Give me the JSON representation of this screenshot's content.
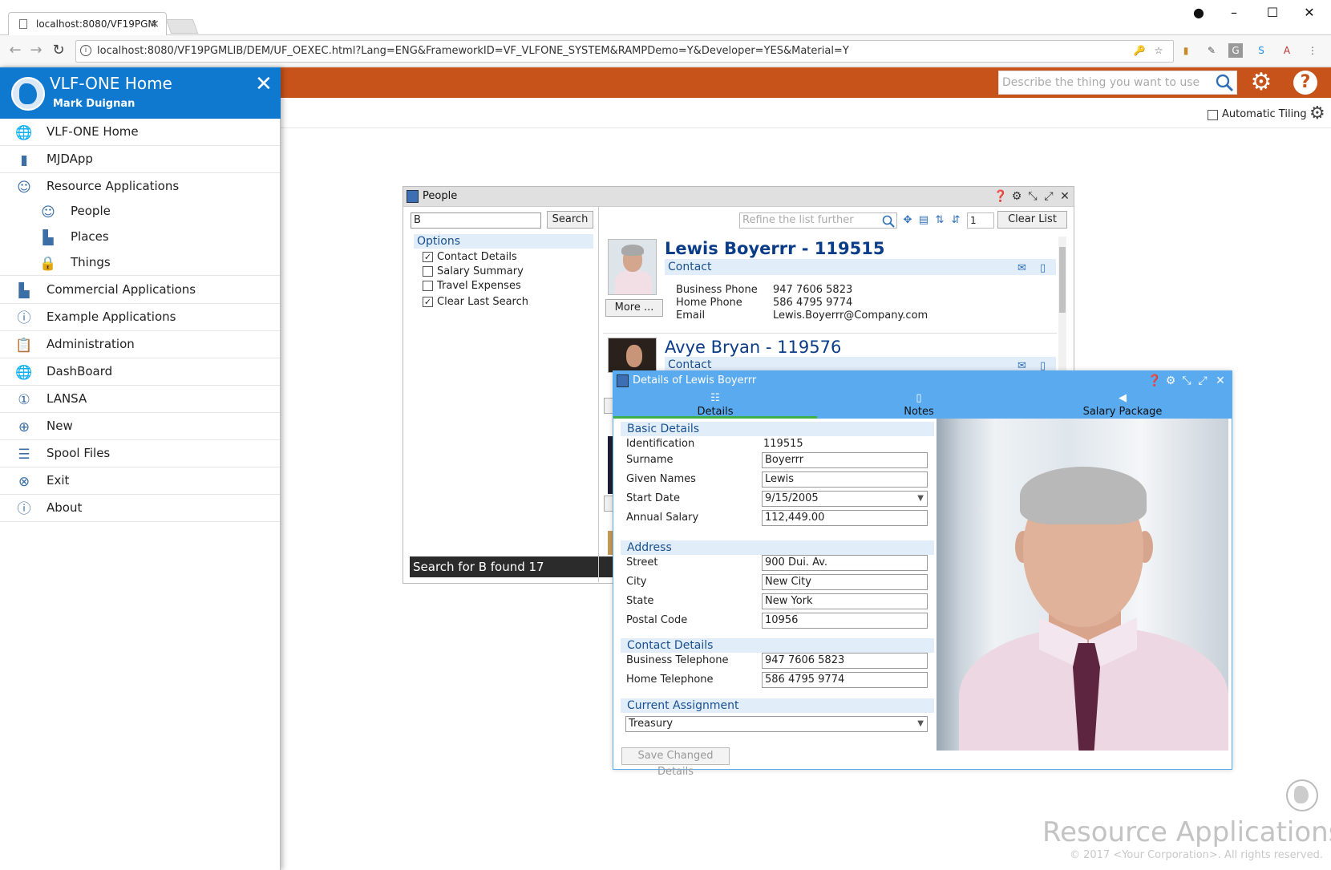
{
  "browser": {
    "tab_title": "localhost:8080/VF19PGM",
    "url": "localhost:8080/VF19PGMLIB/DEM/UF_OEXEC.html?Lang=ENG&FrameworkID=VF_VLFONE_SYSTEM&RAMPDemo=Y&Developer=YES&Material=Y"
  },
  "header": {
    "search_placeholder": "Describe the thing you want to use",
    "auto_tiling_label": "Automatic Tiling",
    "accent_color": "#c7531a"
  },
  "sidebar": {
    "title": "VLF-ONE Home",
    "user": "Mark Duignan",
    "items": [
      {
        "label": "VLF-ONE Home",
        "icon": "globe-icon"
      },
      {
        "label": "MJDApp",
        "icon": "document-icon"
      },
      {
        "label": "Resource Applications",
        "icon": "person-icon"
      },
      {
        "label": "People",
        "icon": "person-icon"
      },
      {
        "label": "Places",
        "icon": "factory-icon"
      },
      {
        "label": "Things",
        "icon": "lock-icon"
      },
      {
        "label": "Commercial Applications",
        "icon": "factory-icon"
      },
      {
        "label": "Example Applications",
        "icon": "info-icon"
      },
      {
        "label": "Administration",
        "icon": "clipboard-icon"
      },
      {
        "label": "DashBoard",
        "icon": "globe-icon"
      },
      {
        "label": "LANSA",
        "icon": "number-one-icon"
      },
      {
        "label": "New",
        "icon": "plus-icon"
      },
      {
        "label": "Spool Files",
        "icon": "list-icon"
      },
      {
        "label": "Exit",
        "icon": "exit-icon"
      },
      {
        "label": "About",
        "icon": "info-icon"
      }
    ]
  },
  "people": {
    "title": "People",
    "search_value": "B",
    "search_button": "Search",
    "options_header": "Options",
    "options": [
      {
        "label": "Contact Details",
        "checked": true
      },
      {
        "label": "Salary Summary",
        "checked": false
      },
      {
        "label": "Travel Expenses",
        "checked": false
      },
      {
        "label": "Clear Last Search",
        "checked": true
      }
    ],
    "status": "Search for B found 17",
    "refine_placeholder": "Refine the list further",
    "page": "1",
    "clear_button": "Clear List",
    "cards": [
      {
        "name": "Lewis Boyerrr - 119515",
        "section": "Contact",
        "more": "More ...",
        "fields": [
          {
            "key": "Business Phone",
            "value": "947 7606 5823"
          },
          {
            "key": "Home Phone",
            "value": "586 4795 9774"
          },
          {
            "key": "Email",
            "value": "Lewis.Boyerrr@Company.com"
          }
        ]
      },
      {
        "name": "Avye Bryan - 119576",
        "section": "Contact"
      }
    ]
  },
  "details": {
    "title": "Details of Lewis Boyerrr",
    "tabs": [
      "Details",
      "Notes",
      "Salary Package"
    ],
    "sections": {
      "basic": "Basic Details",
      "address": "Address",
      "contact": "Contact Details",
      "assignment": "Current Assignment"
    },
    "labels": {
      "identification": "Identification",
      "surname": "Surname",
      "given_names": "Given Names",
      "start_date": "Start Date",
      "annual_salary": "Annual Salary",
      "street": "Street",
      "city": "City",
      "state": "State",
      "postal_code": "Postal Code",
      "business_telephone": "Business Telephone",
      "home_telephone": "Home Telephone"
    },
    "values": {
      "identification": "119515",
      "surname": "Boyerrr",
      "given_names": "Lewis",
      "start_date": "9/15/2005",
      "annual_salary": "112,449.00",
      "street": "900 Dui. Av.",
      "city": "New City",
      "state": "New York",
      "postal_code": "10956",
      "business_telephone": "947 7606 5823",
      "home_telephone": "586 4795 9774",
      "assignment": "Treasury"
    },
    "save_button": "Save Changed Details"
  },
  "watermark": {
    "title": "Resource Applications",
    "copyright": "© 2017 <Your Corporation>. All rights reserved."
  }
}
